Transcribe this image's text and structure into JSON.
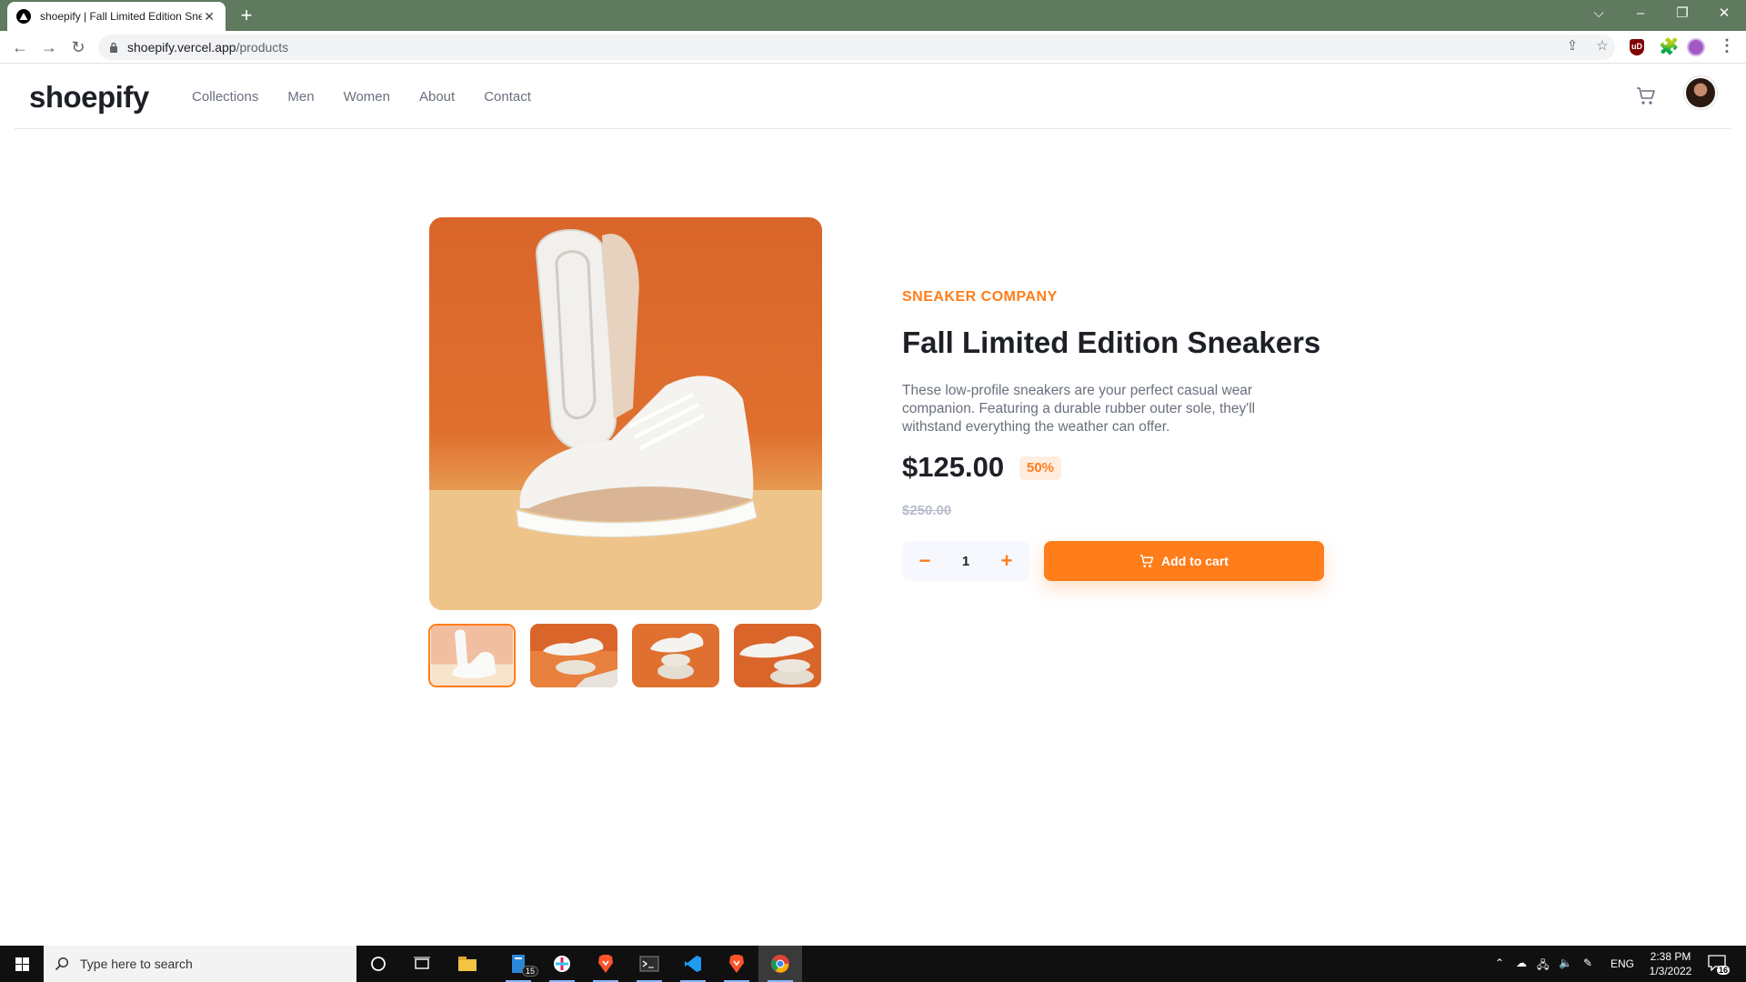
{
  "browser": {
    "tab_title": "shoepify | Fall Limited Edition Sneakers",
    "tab_close": "✕",
    "new_tab": "+",
    "url_host": "shoepify.vercel.app",
    "url_path": "/products",
    "window_controls": {
      "tab_search": "⌵",
      "minimize": "–",
      "restore": "❐",
      "close": "✕"
    },
    "nav": {
      "back": "←",
      "forward": "→",
      "reload": "↻"
    },
    "omnibox_icons": {
      "share": "⇪",
      "bookmark": "☆"
    },
    "extensions": {
      "ublock_label": "uD",
      "puzzle": "🧩",
      "menu": "⋮"
    }
  },
  "site": {
    "logo": "shoepify",
    "nav": [
      "Collections",
      "Men",
      "Women",
      "About",
      "Contact"
    ]
  },
  "product": {
    "company": "SNEAKER COMPANY",
    "title": "Fall Limited Edition Sneakers",
    "description": "These low-profile sneakers are your perfect casual wear companion. Featuring a durable rubber outer sole, they'll withstand everything the weather can offer.",
    "price": "$125.00",
    "discount": "50%",
    "original_price": "$250.00",
    "quantity": "1",
    "decrease": "−",
    "increase": "+",
    "add_to_cart": "Add to cart",
    "thumbnail_count": 4,
    "active_thumbnail": 1
  },
  "colors": {
    "accent": "#ff7d1a",
    "accent_pale": "#ffede0",
    "text_dark": "#1d2026",
    "text_muted": "#69707d",
    "text_light": "#b6bcc8"
  },
  "taskbar": {
    "search_placeholder": "Type here to search",
    "file_explorer_badge": "15",
    "language": "ENG",
    "time": "2:38 PM",
    "date": "1/3/2022",
    "notification_count": "16"
  }
}
